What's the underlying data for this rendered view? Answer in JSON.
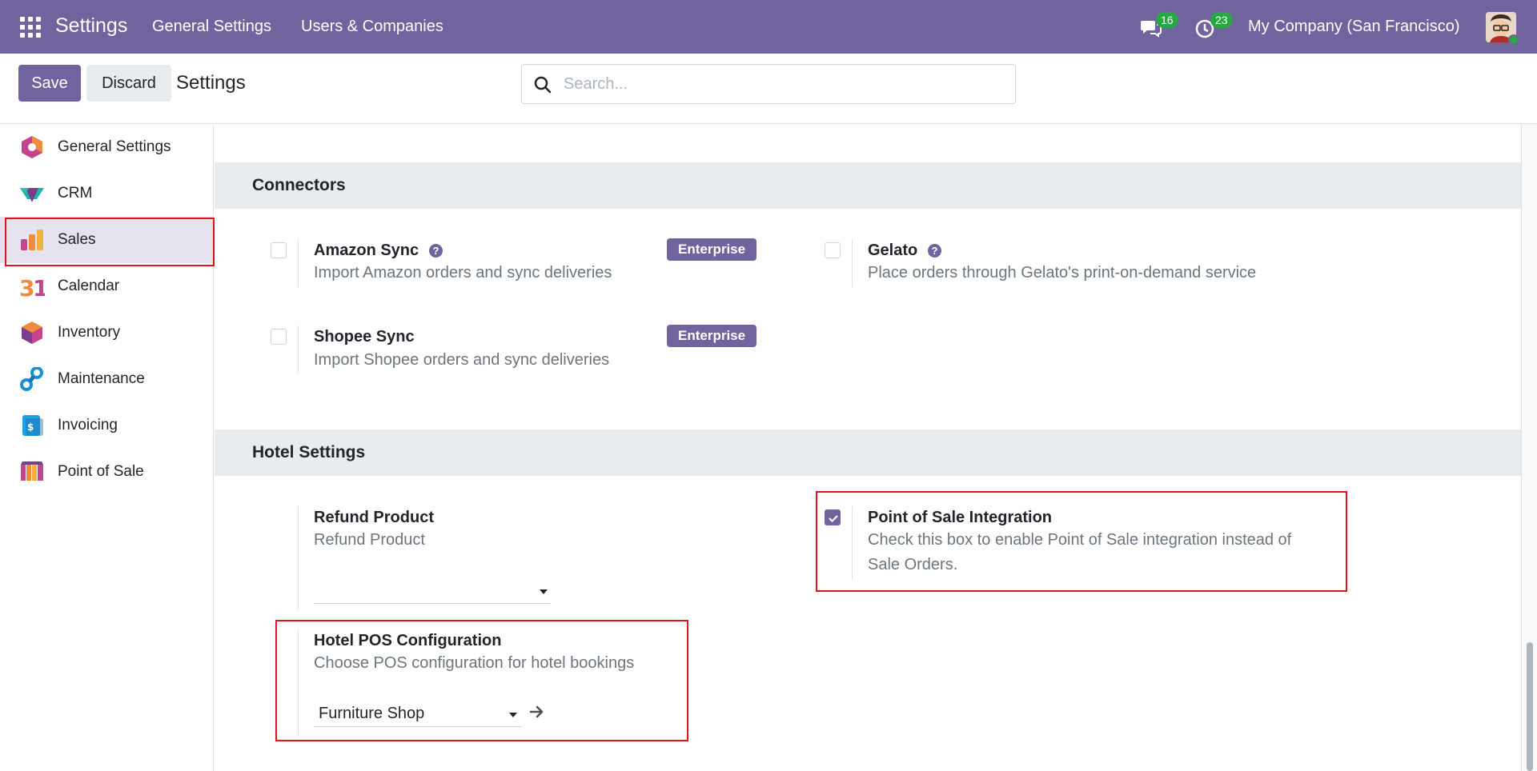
{
  "topbar": {
    "app_title": "Settings",
    "menu": [
      "General Settings",
      "Users & Companies"
    ],
    "messages_count": "16",
    "activities_count": "23",
    "company": "My Company (San Francisco)"
  },
  "control": {
    "save_label": "Save",
    "discard_label": "Discard",
    "title": "Settings",
    "search_placeholder": "Search..."
  },
  "sidebar": {
    "items": [
      {
        "label": "General Settings",
        "icon": "general-settings-icon"
      },
      {
        "label": "CRM",
        "icon": "crm-icon"
      },
      {
        "label": "Sales",
        "icon": "sales-icon",
        "active": true
      },
      {
        "label": "Calendar",
        "icon": "calendar-icon"
      },
      {
        "label": "Inventory",
        "icon": "inventory-icon"
      },
      {
        "label": "Maintenance",
        "icon": "maintenance-icon"
      },
      {
        "label": "Invoicing",
        "icon": "invoicing-icon"
      },
      {
        "label": "Point of Sale",
        "icon": "point-of-sale-icon"
      }
    ]
  },
  "connectors": {
    "heading": "Connectors",
    "amazon": {
      "title": "Amazon Sync",
      "desc": "Import Amazon orders and sync deliveries",
      "badge": "Enterprise",
      "checked": false
    },
    "gelato": {
      "title": "Gelato",
      "desc": "Place orders through Gelato's print-on-demand service",
      "checked": false
    },
    "shopee": {
      "title": "Shopee Sync",
      "desc": "Import Shopee orders and sync deliveries",
      "badge": "Enterprise",
      "checked": false
    }
  },
  "hotel": {
    "heading": "Hotel Settings",
    "refund": {
      "title": "Refund Product",
      "desc": "Refund Product",
      "value": ""
    },
    "pos_integration": {
      "title": "Point of Sale Integration",
      "desc_line1": "Check this box to enable Point of Sale integration instead of",
      "desc_line2": "Sale Orders.",
      "checked": true
    },
    "pos_config": {
      "title": "Hotel POS Configuration",
      "desc": "Choose POS configuration for hotel bookings",
      "value": "Furniture Shop"
    }
  },
  "colors": {
    "brand": "#71639e",
    "highlight": "#e0141e",
    "badge_green": "#28a745"
  }
}
